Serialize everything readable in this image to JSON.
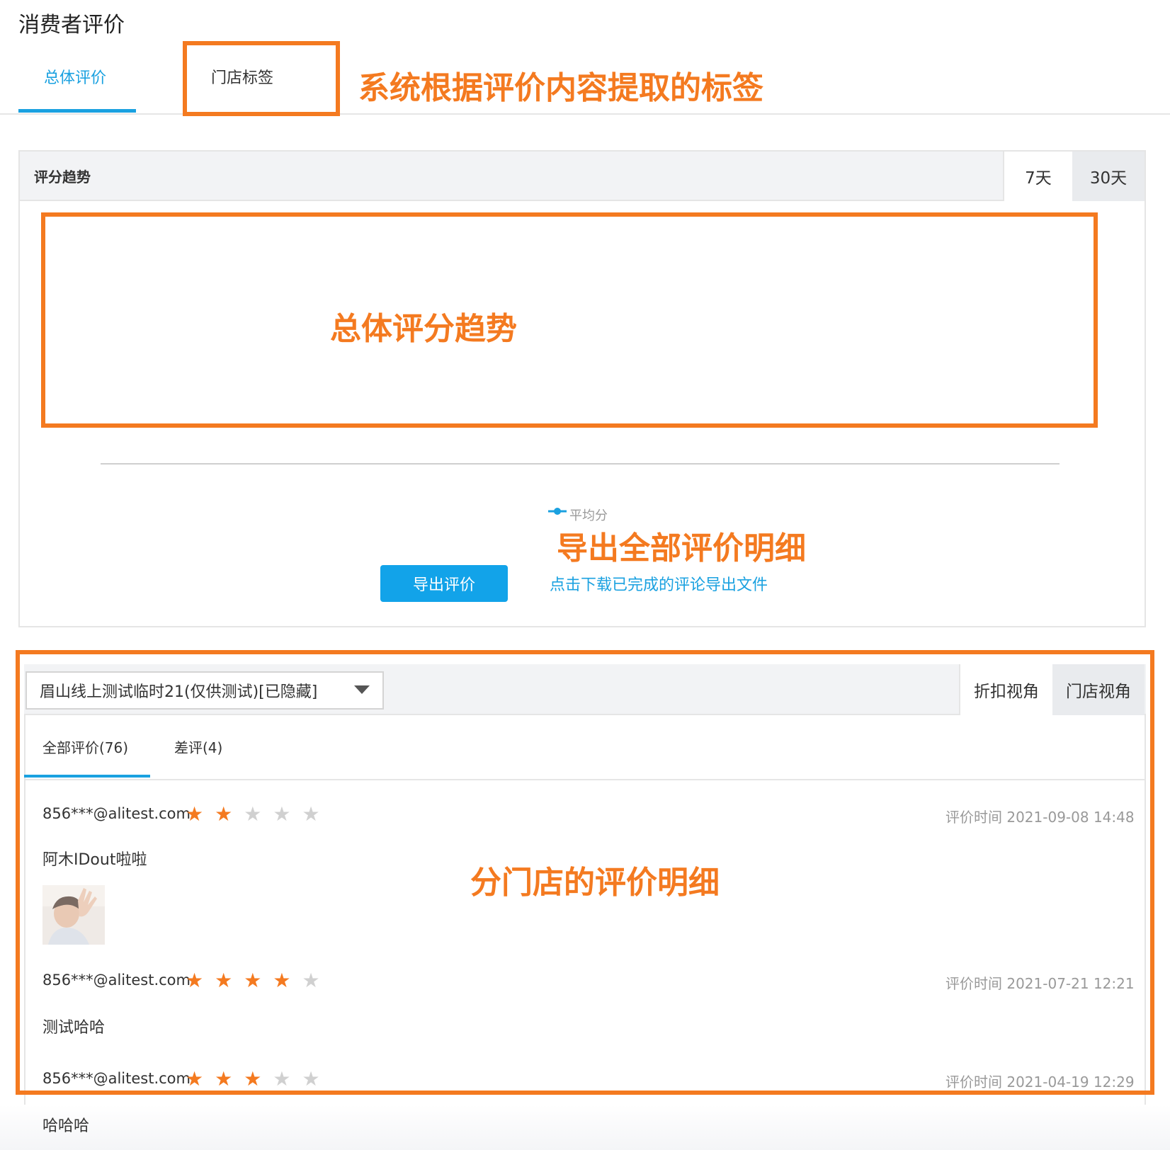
{
  "page": {
    "title": "消费者评价"
  },
  "tabs": {
    "overall": "总体评价",
    "store_tags": "门店标签"
  },
  "trend": {
    "title": "评分趋势",
    "range_7": "7天",
    "range_30": "30天",
    "legend": "平均分",
    "export_button": "导出评价",
    "download_link": "点击下载已完成的评论导出文件"
  },
  "store": {
    "selected": "眉山线上测试临时21(仅供测试)[已隐藏]",
    "view_discount": "折扣视角",
    "view_store": "门店视角",
    "tab_all": "全部评价(76)",
    "tab_bad": "差评(4)"
  },
  "reviews": [
    {
      "user": "856***@alitest.com",
      "rating": 2,
      "time": "评价时间 2021-09-08 14:48",
      "text": "阿木IDout啦啦"
    },
    {
      "user": "856***@alitest.com",
      "rating": 4,
      "time": "评价时间 2021-07-21 12:21",
      "text": "测试哈哈"
    },
    {
      "user": "856***@alitest.com",
      "rating": 3,
      "time": "评价时间 2021-04-19 12:29",
      "text": "哈哈哈"
    }
  ],
  "annotations": {
    "tags_note": "系统根据评价内容提取的标签",
    "trend_note": "总体评分趋势",
    "export_note": "导出全部评价明细",
    "detail_note": "分门店的评价明细"
  },
  "colors": {
    "accent": "#1aa1e0",
    "annotation": "#f47a20",
    "star_on": "#f47a20",
    "star_off": "#d0d0d0"
  },
  "icons": {
    "dropdown": "caret-down-icon",
    "star": "star-icon",
    "legend": "line-dot-legend-icon"
  }
}
